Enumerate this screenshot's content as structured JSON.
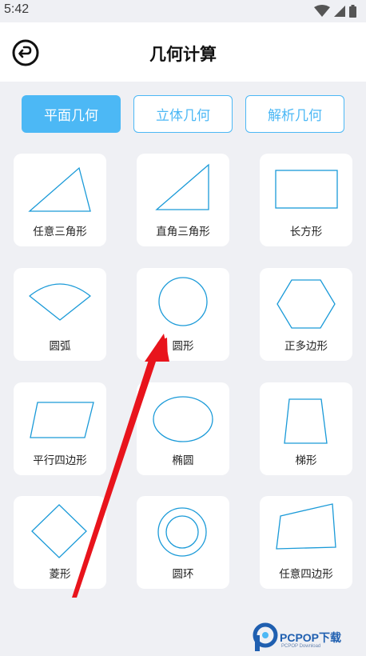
{
  "status_bar": {
    "time": "5:42"
  },
  "header": {
    "title": "几何计算"
  },
  "tabs": [
    {
      "label": "平面几何",
      "active": true
    },
    {
      "label": "立体几何",
      "active": false
    },
    {
      "label": "解析几何",
      "active": false
    }
  ],
  "shapes": [
    {
      "label": "任意三角形",
      "icon": "triangle-icon"
    },
    {
      "label": "直角三角形",
      "icon": "right-triangle-icon"
    },
    {
      "label": "长方形",
      "icon": "rectangle-icon"
    },
    {
      "label": "圆弧",
      "icon": "arc-sector-icon"
    },
    {
      "label": "圆形",
      "icon": "circle-icon"
    },
    {
      "label": "正多边形",
      "icon": "hexagon-icon"
    },
    {
      "label": "平行四边形",
      "icon": "parallelogram-icon"
    },
    {
      "label": "椭圆",
      "icon": "ellipse-icon"
    },
    {
      "label": "梯形",
      "icon": "trapezoid-icon"
    },
    {
      "label": "菱形",
      "icon": "rhombus-icon"
    },
    {
      "label": "圆环",
      "icon": "ring-icon"
    },
    {
      "label": "任意四边形",
      "icon": "quadrilateral-icon"
    }
  ],
  "watermark": {
    "text": "PCPOP下载",
    "sub": "PCPOP Download"
  },
  "colors": {
    "accent": "#4cb8f5",
    "shape_stroke": "#1a9ad8",
    "annotation_arrow": "#e8141c"
  }
}
